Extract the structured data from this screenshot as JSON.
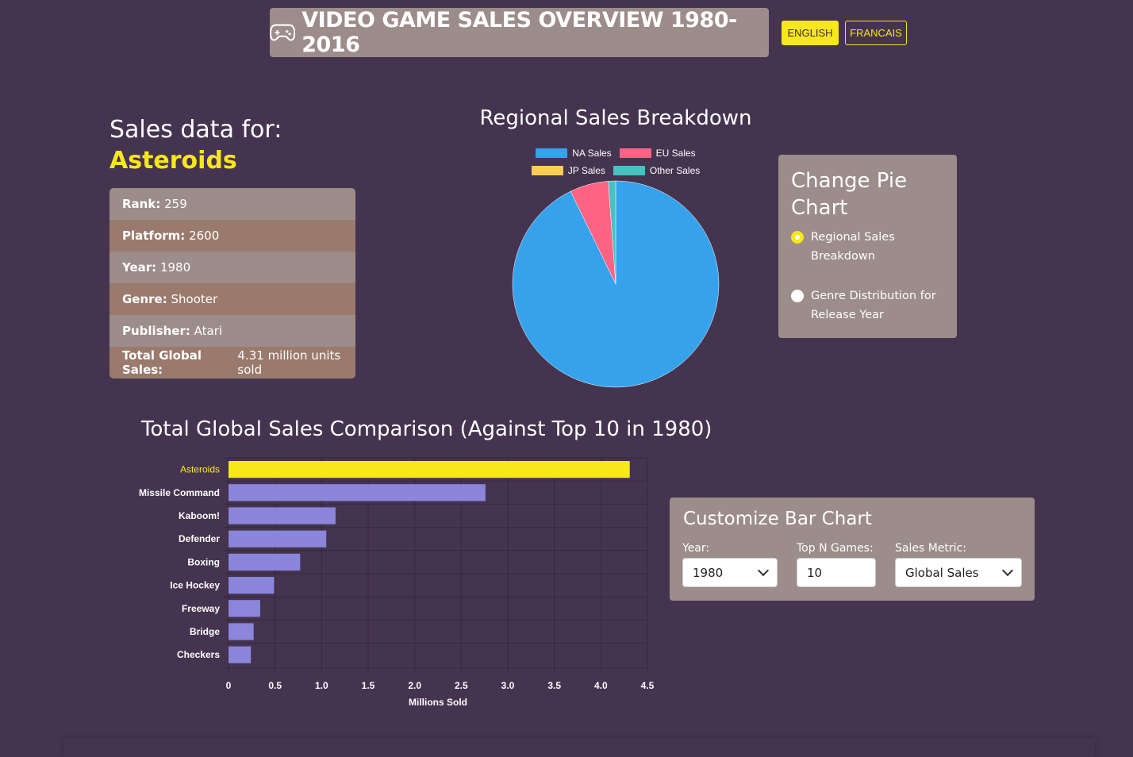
{
  "header": {
    "title": "VIDEO GAME SALES OVERVIEW 1980-2016",
    "icon": "gamepad-icon",
    "lang_english": "ENGLISH",
    "lang_french": "FRANCAIS"
  },
  "game": {
    "sales_for_label": "Sales data for:",
    "name": "Asteroids",
    "rows": [
      {
        "label": "Rank:",
        "value": "259"
      },
      {
        "label": "Platform:",
        "value": "2600"
      },
      {
        "label": "Year:",
        "value": "1980"
      },
      {
        "label": "Genre:",
        "value": "Shooter"
      },
      {
        "label": "Publisher:",
        "value": "Atari"
      },
      {
        "label": "Total Global Sales:",
        "value": "4.31 million units sold"
      }
    ]
  },
  "pie_panel": {
    "title": "Change Pie Chart",
    "options": [
      {
        "label": "Regional Sales Breakdown",
        "checked": true
      },
      {
        "label": "Genre Distribution for Release Year",
        "checked": false
      }
    ]
  },
  "bar_panel": {
    "title": "Customize Bar Chart",
    "year_label": "Year:",
    "year_value": "1980",
    "topn_label": "Top N Games:",
    "topn_value": "10",
    "metric_label": "Sales Metric:",
    "metric_value": "Global Sales"
  },
  "colors": {
    "highlight": "#f8e71c",
    "bar": "#8b86dc",
    "na": "#36a2eb",
    "eu": "#ff6384",
    "jp": "#ffcd56",
    "other": "#4bc0c0"
  },
  "chart_data": [
    {
      "type": "pie",
      "title": "Regional Sales Breakdown",
      "series": [
        {
          "name": "NA Sales",
          "value": 4.0
        },
        {
          "name": "EU Sales",
          "value": 0.26
        },
        {
          "name": "JP Sales",
          "value": 0
        },
        {
          "name": "Other Sales",
          "value": 0.05
        }
      ],
      "legend": "top"
    },
    {
      "type": "bar",
      "orientation": "horizontal",
      "title": "Total Global Sales Comparison (Against Top 10 in 1980)",
      "categories": [
        "Asteroids",
        "Missile Command",
        "Kaboom!",
        "Defender",
        "Boxing",
        "Ice Hockey",
        "Freeway",
        "Bridge",
        "Checkers"
      ],
      "values": [
        4.31,
        2.76,
        1.15,
        1.05,
        0.77,
        0.49,
        0.34,
        0.27,
        0.24
      ],
      "highlight": "Asteroids",
      "xlabel": "Millions Sold",
      "xlim": [
        0,
        4.5
      ],
      "xticks": [
        "0",
        "0.5",
        "1.0",
        "1.5",
        "2.0",
        "2.5",
        "3.0",
        "3.5",
        "4.0",
        "4.5"
      ],
      "grid": true
    }
  ]
}
